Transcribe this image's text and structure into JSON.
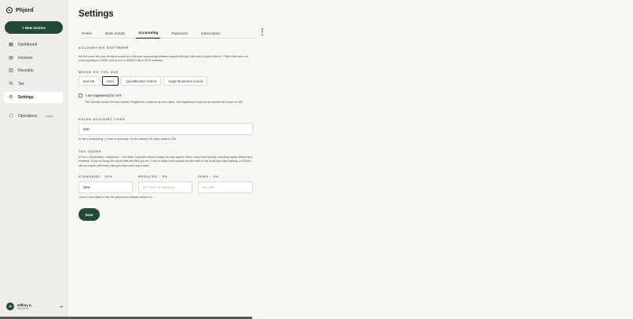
{
  "brand": {
    "name": "Phjord",
    "icon": "play-circle-icon"
  },
  "sidebar": {
    "new_invoice_label": "+ New invoice",
    "items": [
      {
        "label": "Dashboard",
        "icon": "grid-icon",
        "active": false
      },
      {
        "label": "Invoices",
        "icon": "document-icon",
        "active": false
      },
      {
        "label": "Receipts",
        "icon": "receipt-icon",
        "active": false
      },
      {
        "label": "Tax",
        "icon": "percent-icon",
        "active": false
      },
      {
        "label": "Settings",
        "icon": "gear-icon",
        "active": true
      }
    ],
    "operations": {
      "label": "Operations",
      "badge": "Insider",
      "icon": "shield-icon"
    }
  },
  "profile": {
    "initials": "JA",
    "name": "Jeffery A.",
    "plan": "MONTHLY"
  },
  "page": {
    "title": "Settings"
  },
  "tabs": [
    {
      "label": "Profile",
      "active": false
    },
    {
      "label": "Bank details",
      "active": false
    },
    {
      "label": "Accounting",
      "active": true
    },
    {
      "label": "Password",
      "active": false
    },
    {
      "label": "Subscription",
      "active": false
    }
  ],
  "accounting": {
    "section_label": "Accounting Software",
    "description": "Set the once and your invoices export as a file your accounting software imports directly, with every column filled in. Phjord still does not send anything to HMRC and is not on HMRC's list of MTD software.",
    "which_label": "Which do you use",
    "options": [
      {
        "label": "Not set",
        "selected": false
      },
      {
        "label": "Xero",
        "selected": true
      },
      {
        "label": "QuickBooks Online",
        "selected": false
      },
      {
        "label": "Sage Business Cloud",
        "selected": false
      }
    ],
    "vat_checkbox_label": "I am registered for VAT",
    "vat_help": "This decides what a 0% line means. Registered, it exports as zero rated. Not registered, it exports as outside the scope of VAT.",
    "sales_account_label": "Sales account code",
    "sales_account_value": "200",
    "sales_account_help": "In Xero: Accounting > Chart of accounts. On the default UK chart, sales is 200.",
    "tax_codes_label": "Tax codes",
    "tax_codes_help": "In Xero: Accounting > Advanced > Tax rates. Copy the names exactly as they appear there. Copy them exactly, including capital letters and brackets. If one is wrong the import fails and tells you so. If one is blank Xero imports the line with no tax at all and says nothing, so Phjord will not export until every rate you have used has a code.",
    "rates": [
      {
        "label": "Standard · 20%",
        "value": "20%",
        "placeholder": ""
      },
      {
        "label": "Reduced · 5%",
        "value": "",
        "placeholder": "5% (VAT on Income)"
      },
      {
        "label": "Zero · 0%",
        "value": "",
        "placeholder": "No VAT"
      }
    ],
    "blank_help": "Leave a box blank to use the greyed-out default shown in it.",
    "save_label": "Save"
  }
}
